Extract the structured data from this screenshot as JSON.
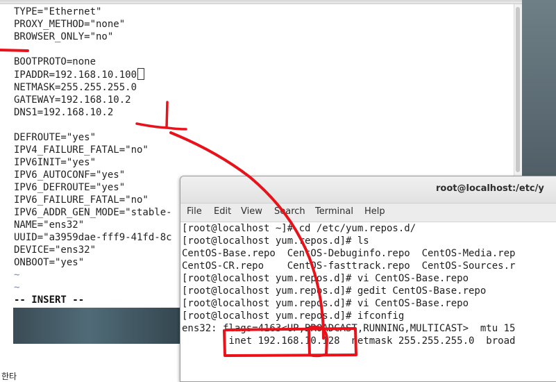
{
  "vi_editor": {
    "lines": [
      "TYPE=\"Ethernet\"",
      "PROXY_METHOD=\"none\"",
      "BROWSER_ONLY=\"no\"",
      "",
      "BOOTPROTO=none",
      "IPADDR=192.168.10.100",
      "NETMASK=255.255.255.0",
      "GATEWAY=192.168.10.2",
      "DNS1=192.168.10.2",
      "",
      "DEFROUTE=\"yes\"",
      "IPV4_FAILURE_FATAL=\"no\"",
      "IPV6INIT=\"yes\"",
      "IPV6_AUTOCONF=\"yes\"",
      "IPV6_DEFROUTE=\"yes\"",
      "IPV6_FAILURE_FATAL=\"no\"",
      "IPV6_ADDR_GEN_MODE=\"stable-",
      "NAME=\"ens32\"",
      "UUID=\"a3959dae-fff9-41fd-8c",
      "DEVICE=\"ens32\"",
      "ONBOOT=\"yes\""
    ],
    "tilde_lines": [
      "~",
      "~"
    ],
    "mode_indicator": "-- INSERT --",
    "cursor_line_index": 5
  },
  "terminal": {
    "title": "root@localhost:/etc/y",
    "menu": [
      "File",
      "Edit",
      "View",
      "Search",
      "Terminal",
      "Help"
    ],
    "lines": [
      "[root@localhost ~]# cd /etc/yum.repos.d/",
      "[root@localhost yum.repos.d]# ls",
      "CentOS-Base.repo  CentOS-Debuginfo.repo  CentOS-Media.rep",
      "CentOS-CR.repo    CentOS-fasttrack.repo  CentOS-Sources.r",
      "[root@localhost yum.repos.d]# vi CentOS-Base.repo",
      "[root@localhost yum.repos.d]# gedit CentOS-Base.repo",
      "[root@localhost yum.repos.d]# vi CentOS-Base.repo",
      "[root@localhost yum.repos.d]# ifconfig",
      "ens32: flags=4163<UP,BROADCAST,RUNNING,MULTICAST>  mtu 15",
      "        inet 192.168.10.128  netmask 255.255.255.0  broad"
    ]
  },
  "ime_indicator": "한타",
  "colors": {
    "annotation": "#e8121a",
    "vi_tilde": "#6f86d6",
    "terminal_titlebar": "#e6e6e6"
  }
}
